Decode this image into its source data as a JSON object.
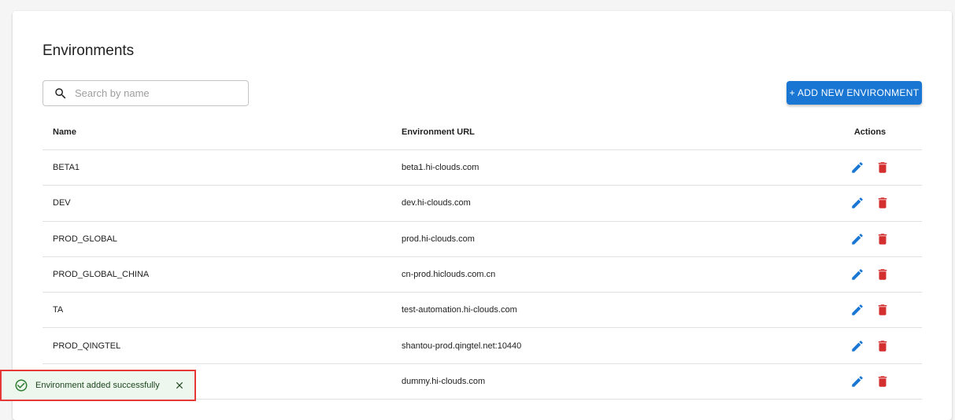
{
  "page": {
    "title": "Environments"
  },
  "search": {
    "placeholder": "Search by name",
    "value": ""
  },
  "toolbar": {
    "add_label": "+ ADD NEW ENVIRONMENT"
  },
  "table": {
    "headers": {
      "name": "Name",
      "url": "Environment URL",
      "actions": "Actions"
    },
    "rows": [
      {
        "name": "BETA1",
        "url": "beta1.hi-clouds.com"
      },
      {
        "name": "DEV",
        "url": "dev.hi-clouds.com"
      },
      {
        "name": "PROD_GLOBAL",
        "url": "prod.hi-clouds.com"
      },
      {
        "name": "PROD_GLOBAL_CHINA",
        "url": "cn-prod.hiclouds.com.cn"
      },
      {
        "name": "TA",
        "url": "test-automation.hi-clouds.com"
      },
      {
        "name": "PROD_QINGTEL",
        "url": "shantou-prod.qingtel.net:10440"
      },
      {
        "name": "",
        "url": "dummy.hi-clouds.com"
      }
    ]
  },
  "toast": {
    "message": "Environment added successfully"
  },
  "colors": {
    "primary": "#1976d2",
    "delete": "#d32f2f",
    "success": "#2e7d32"
  },
  "icons": {
    "search": "search-icon",
    "edit": "pencil-icon",
    "delete": "trash-icon",
    "success": "check-circle-icon",
    "close": "close-icon"
  }
}
